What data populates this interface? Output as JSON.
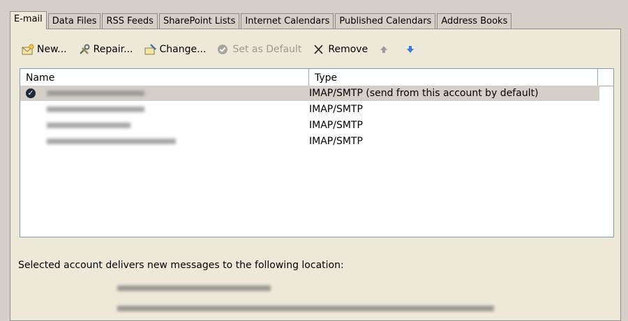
{
  "tabs": [
    "E-mail",
    "Data Files",
    "RSS Feeds",
    "SharePoint Lists",
    "Internet Calendars",
    "Published Calendars",
    "Address Books"
  ],
  "active_tab": "E-mail",
  "toolbar": {
    "new_label": "New...",
    "repair_label": "Repair...",
    "change_label": "Change...",
    "set_default_label": "Set as Default",
    "remove_label": "Remove"
  },
  "accounts_list": {
    "columns": [
      "Name",
      "Type"
    ],
    "rows": [
      {
        "type": "IMAP/SMTP (send from this account by default)",
        "is_default": true
      },
      {
        "type": "IMAP/SMTP",
        "is_default": false
      },
      {
        "type": "IMAP/SMTP",
        "is_default": false
      },
      {
        "type": "IMAP/SMTP",
        "is_default": false
      }
    ]
  },
  "location_label": "Selected account delivers new messages to the following location:",
  "colors": {
    "window_bg": "#d4d0c8",
    "panel_bg": "#ece9d8",
    "selected_row": "#d4d0c8",
    "up_arrow": "#9a9a9a",
    "down_arrow": "#3a7bd5"
  }
}
